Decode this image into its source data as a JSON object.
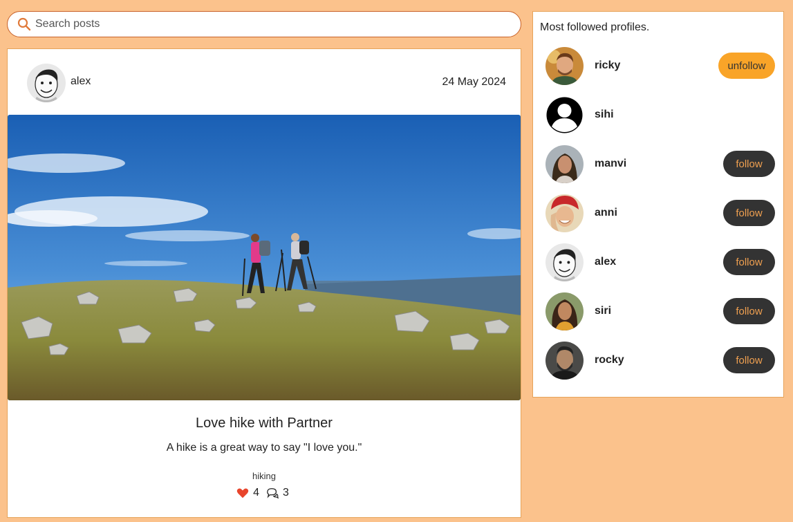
{
  "search": {
    "placeholder": "Search posts"
  },
  "post": {
    "author": "alex",
    "date": "24 May 2024",
    "title": "Love hike with Partner",
    "text": "A hike is a great way to say \"I love you.\"",
    "tag": "hiking",
    "likes": "4",
    "comments": "3"
  },
  "sidebar": {
    "title": "Most followed profiles.",
    "profiles": [
      {
        "name": "ricky",
        "action": "unfollow"
      },
      {
        "name": "sihi",
        "action": ""
      },
      {
        "name": "manvi",
        "action": "follow"
      },
      {
        "name": "anni",
        "action": "follow"
      },
      {
        "name": "alex",
        "action": "follow"
      },
      {
        "name": "siri",
        "action": "follow"
      },
      {
        "name": "rocky",
        "action": "follow"
      }
    ]
  },
  "colors": {
    "background": "#fbc28c",
    "accent_orange": "#f9a428",
    "follow_button": "#333333",
    "like_heart": "#e8452c"
  },
  "icons": {
    "search": "search-icon",
    "like": "heart-icon",
    "comment": "comment-icon"
  }
}
